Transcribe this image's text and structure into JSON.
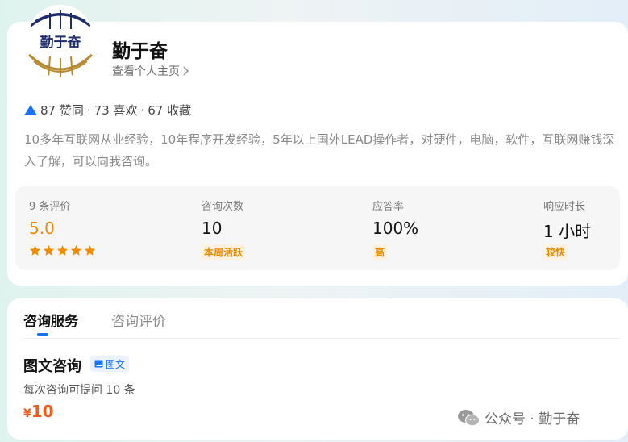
{
  "profile": {
    "logo_text": "勤于奋",
    "name": "勤于奋",
    "profile_link": "查看个人主页",
    "stats": {
      "upvotes": "87 赞同",
      "sep1": "·",
      "likes": "73 喜欢",
      "sep2": "·",
      "favorites": "67 收藏"
    },
    "bio": "10多年互联网从业经验，10年程序开发经验，5年以上国外LEAD操作者，对硬件，电脑，软件，互联网赚钱深入了解，可以向我咨询。"
  },
  "metrics": {
    "reviews": {
      "label": "9 条评价",
      "value": "5.0",
      "stars": 5
    },
    "consults": {
      "label": "咨询次数",
      "value": "10",
      "tag": "本周活跃"
    },
    "response_rate": {
      "label": "应答率",
      "value": "100%",
      "tag": "高"
    },
    "response_time": {
      "label": "响应时长",
      "value": "1 小时",
      "tag": "较快"
    }
  },
  "tabs": [
    {
      "label": "咨询服务",
      "active": true
    },
    {
      "label": "咨询评价",
      "active": false
    }
  ],
  "service": {
    "title": "图文咨询",
    "badge": "图文",
    "desc": "每次咨询可提问 10 条",
    "currency": "¥",
    "price": "10"
  },
  "watermark": "公众号 · 勤于奋",
  "colors": {
    "accent_blue": "#1772f6",
    "orange": "#f08c00",
    "price_red": "#f25a1d"
  },
  "icons": {
    "upvote": "triangle-up-icon",
    "chevron": "chevron-right-icon",
    "star": "star-icon",
    "image": "image-icon",
    "wechat": "wechat-icon"
  }
}
